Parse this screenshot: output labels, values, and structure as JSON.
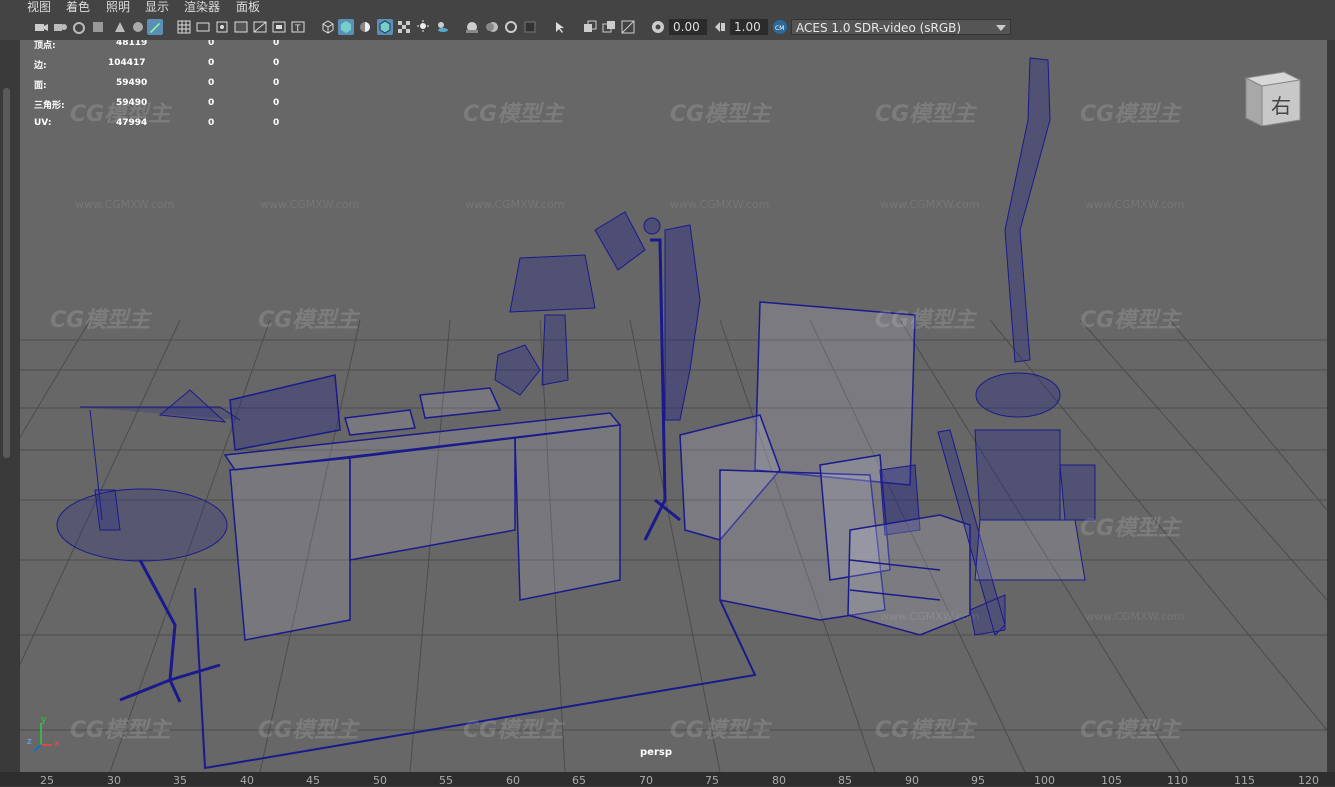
{
  "menu": [
    "视图",
    "着色",
    "照明",
    "显示",
    "渲染器",
    "面板"
  ],
  "toolbar": {
    "exposure_value": "0.00",
    "gamma_value": "1.00",
    "color_space": "ACES 1.0 SDR-video (sRGB)"
  },
  "hud": {
    "rows": [
      {
        "label": "顶点:",
        "a": "48119",
        "b": "0",
        "c": "0"
      },
      {
        "label": "边:",
        "a": "104417",
        "b": "0",
        "c": "0"
      },
      {
        "label": "面:",
        "a": "59490",
        "b": "0",
        "c": "0"
      },
      {
        "label": "三角形:",
        "a": "59490",
        "b": "0",
        "c": "0"
      },
      {
        "label": "UV:",
        "a": "47994",
        "b": "0",
        "c": "0"
      }
    ]
  },
  "viewcube_label": "右",
  "camera_label": "persp",
  "axis_labels": {
    "y": "y",
    "z": "z",
    "x": "x"
  },
  "watermark": {
    "logo": "CG模型主",
    "url": "www.CGMXW.com"
  },
  "timeline_ticks": [
    "25",
    "30",
    "35",
    "40",
    "45",
    "50",
    "55",
    "60",
    "65",
    "70",
    "75",
    "80",
    "85",
    "90",
    "95",
    "100",
    "105",
    "110",
    "115",
    "120"
  ],
  "colors": {
    "viewport_bg": "#676767",
    "wire": "#1a1a8c",
    "grid": "#4a4a4a",
    "accent": "#5a8fb8"
  }
}
